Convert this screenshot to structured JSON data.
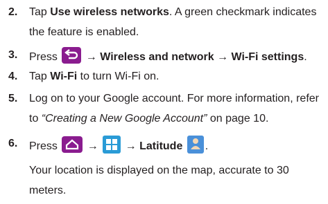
{
  "steps": [
    {
      "num": "2.",
      "line1_pre": "Tap ",
      "line1_bold": "Use wireless networks",
      "line1_post": ". A green checkmark indicates",
      "line2": "the feature is enabled."
    },
    {
      "num": "3.",
      "pre": "Press ",
      "post": " → Wireless and network → Wi-Fi settings",
      "end": "."
    },
    {
      "num": "4.",
      "pre": "Tap ",
      "bold": "Wi-Fi",
      "post": " to turn Wi-Fi on."
    },
    {
      "num": "5.",
      "line1": "Log on to your Google account. For more information, refer",
      "line2_pre": "to ",
      "line2_italic": "“Creating a New Google Account”",
      "line2_post": " on page 10."
    },
    {
      "num": "6.",
      "pre": "Press ",
      "arrow1": " → ",
      "arrow2": " → Latitude ",
      "end": ".",
      "note_line1": "Your location is displayed on the map, accurate to 30",
      "note_line2": "meters."
    }
  ],
  "icons": {
    "back": "back-icon",
    "home": "home-icon",
    "apps": "apps-icon",
    "latitude": "latitude-icon"
  }
}
